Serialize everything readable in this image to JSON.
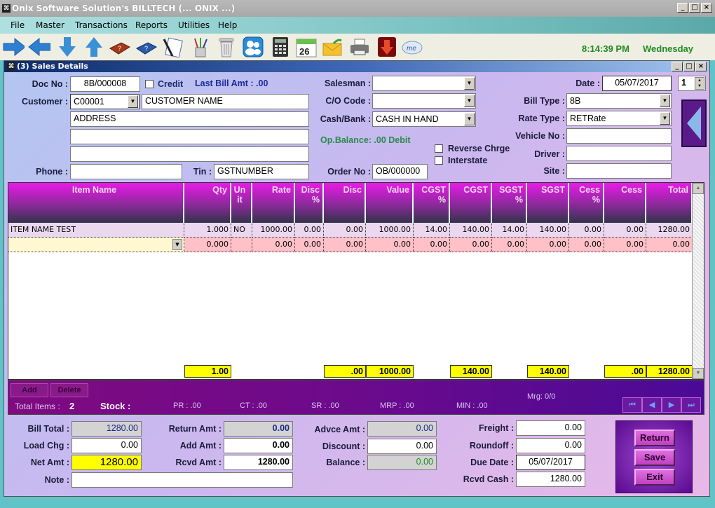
{
  "app": {
    "title": "Onix Software Solution's BILLTECH (... ONIX ...)",
    "window_buttons": [
      "_",
      "□",
      "×"
    ]
  },
  "menu": [
    "File",
    "Master",
    "Transactions",
    "Reports",
    "Utilities",
    "Help"
  ],
  "toolbar": {
    "icons": [
      "arrow-right-icon",
      "arrow-left-icon",
      "arrow-down-icon",
      "arrow-up-icon",
      "help-book-red-icon",
      "help-book-blue-icon",
      "notes-pen-icon",
      "brushes-icon",
      "trash-icon",
      "users-icon",
      "calculator-icon",
      "calendar-icon",
      "mail-icon",
      "printer-icon",
      "download-icon",
      "cloud-me-icon"
    ],
    "calendar_day": "26",
    "time": "8:14:39 PM",
    "day": "Wednesday"
  },
  "child": {
    "title": "(3) Sales Details"
  },
  "header": {
    "doc_no_label": "Doc No  :",
    "doc_no": "8B/000008",
    "credit_label": "Credit",
    "last_bill_label": "Last Bill Amt  :  .00",
    "customer_label": "Customer  :",
    "customer_code": "C00001",
    "customer_name": "CUSTOMER NAME",
    "address1": "ADDRESS",
    "address2": "",
    "address3": "",
    "phone_label": "Phone  :",
    "phone": "",
    "tin_label": "Tin  :",
    "tin": "GSTNUMBER",
    "salesman_label": "Salesman  :",
    "salesman": "",
    "co_code_label": "C/O Code  :",
    "co_code": "",
    "cash_bank_label": "Cash/Bank  :",
    "cash_bank": "CASH IN HAND",
    "op_balance": "Op.Balance:  .00  Debit",
    "reverse_charge_label": "Reverse Chrge",
    "interstate_label": "Interstate",
    "order_no_label": "Order No  :",
    "order_no": "OB/000000",
    "date_label": "Date  :",
    "date": "05/07/2017",
    "counter": "1",
    "bill_type_label": "Bill Type  :",
    "bill_type": "8B",
    "rate_type_label": "Rate Type  :",
    "rate_type": "RETRate",
    "vehicle_label": "Vehicle No  :",
    "vehicle": "",
    "driver_label": "Driver  :",
    "driver": "",
    "site_label": "Site  :",
    "site": ""
  },
  "grid": {
    "columns": [
      "Item Name",
      "Qty",
      "Un\nit",
      "Rate",
      "Disc\n%",
      "Disc",
      "Value",
      "CGST\n%",
      "CGST",
      "SGST\n%",
      "SGST",
      "Cess\n%",
      "Cess",
      "Total"
    ],
    "rows": [
      [
        "ITEM NAME TEST",
        "1.000",
        "NO",
        "1000.00",
        "0.00",
        "0.00",
        "1000.00",
        "14.00",
        "140.00",
        "14.00",
        "140.00",
        "0.00",
        "0.00",
        "1280.00"
      ],
      [
        "",
        "0.000",
        "",
        "0.00",
        "0.00",
        "0.00",
        "0.00",
        "0.00",
        "0.00",
        "0.00",
        "0.00",
        "0.00",
        "0.00",
        "0.00"
      ]
    ],
    "totals": {
      "qty": "1.00",
      "disc": ".00",
      "value": "1000.00",
      "cgst": "140.00",
      "sgst": "140.00",
      "cess": ".00",
      "total": "1280.00"
    }
  },
  "band": {
    "add_label": "Add",
    "delete_label": "Delete",
    "total_items_label": "Total Items  :",
    "total_items": "2",
    "stock_label": "Stock :",
    "pr": "PR : .00",
    "ct": "CT : .00",
    "sr": "SR : .00",
    "mrp": "MRP : .00",
    "min": "MIN : .00",
    "mrg": "Mrg: 0/0"
  },
  "footer": {
    "bill_total_label": "Bill Total  :",
    "bill_total": "1280.00",
    "load_chg_label": "Load Chg  :",
    "load_chg": "0.00",
    "net_amt_label": "Net Amt  :",
    "net_amt": "1280.00",
    "note_label": "Note  :",
    "note": "",
    "return_amt_label": "Return Amt  :",
    "return_amt": "0.00",
    "add_amt_label": "Add Amt  :",
    "add_amt": "0.00",
    "rcvd_amt_label": "Rcvd Amt  :",
    "rcvd_amt": "1280.00",
    "advce_amt_label": "Advce Amt  :",
    "advce_amt": "0.00",
    "discount_label": "Discount  :",
    "discount": "0.00",
    "balance_label": "Balance  :",
    "balance": "0.00",
    "freight_label": "Freight  :",
    "freight": "0.00",
    "roundoff_label": "Roundoff  :",
    "roundoff": "0.00",
    "due_date_label": "Due Date  :",
    "due_date": "05/07/2017",
    "rcvd_cash_label": "Rcvd Cash  :",
    "rcvd_cash": "1280.00",
    "return_btn": "Return",
    "save_btn": "Save",
    "exit_btn": "Exit"
  },
  "colors": {
    "accent": "#800a80",
    "header_magenta": "#e81ae8",
    "total_yellow": "#ffff00",
    "clock_green": "#218a21",
    "link_blue": "#1a2a9a"
  }
}
